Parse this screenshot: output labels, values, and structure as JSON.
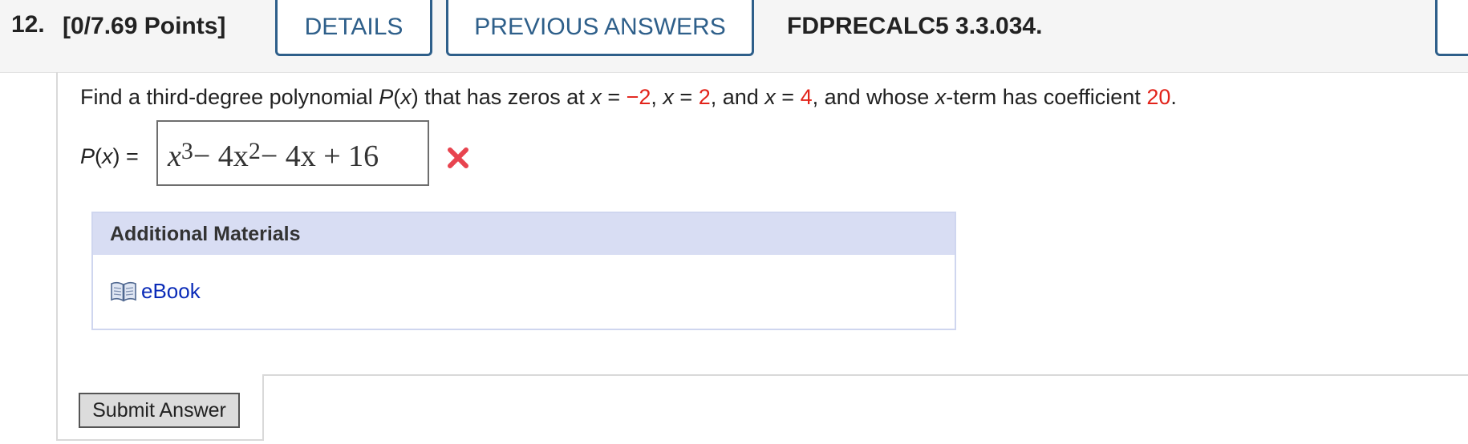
{
  "header": {
    "question_number": "12.",
    "points": "[0/7.69 Points]",
    "details_label": "DETAILS",
    "previous_answers_label": "PREVIOUS ANSWERS",
    "problem_id": "FDPRECALC5 3.3.034."
  },
  "question": {
    "part1": "Find a third-degree polynomial ",
    "poly_name": "P",
    "part2": "(",
    "var": "x",
    "part3": ") that has zeros at  ",
    "x1": "x",
    "eq1": " = ",
    "v1": "−2",
    "sep1": ", ",
    "x2": "x",
    "eq2": " = ",
    "v2": "2",
    "sep2": ", and ",
    "x3": "x",
    "eq3": " = ",
    "v3": "4",
    "part4": ",  and whose ",
    "x4": "x",
    "part5": "-term has coefficient ",
    "coef": "20",
    "end": "."
  },
  "answer": {
    "label_p": "P",
    "label_open": "(",
    "label_x": "x",
    "label_close": ") = ",
    "t1": "x",
    "e1": "3",
    "t2": " − 4x",
    "e2": "2",
    "t3": " − 4x + 16",
    "status_icon": "wrong-x-icon",
    "status_color": "#e8444f"
  },
  "materials": {
    "title": "Additional Materials",
    "ebook_label": "eBook",
    "ebook_icon": "book-icon"
  },
  "submit_label": "Submit Answer",
  "colors": {
    "accent": "#2e5f8a",
    "highlight": "#e2231a",
    "link": "#0a2bb8",
    "materials_bg": "#d8ddf3"
  }
}
